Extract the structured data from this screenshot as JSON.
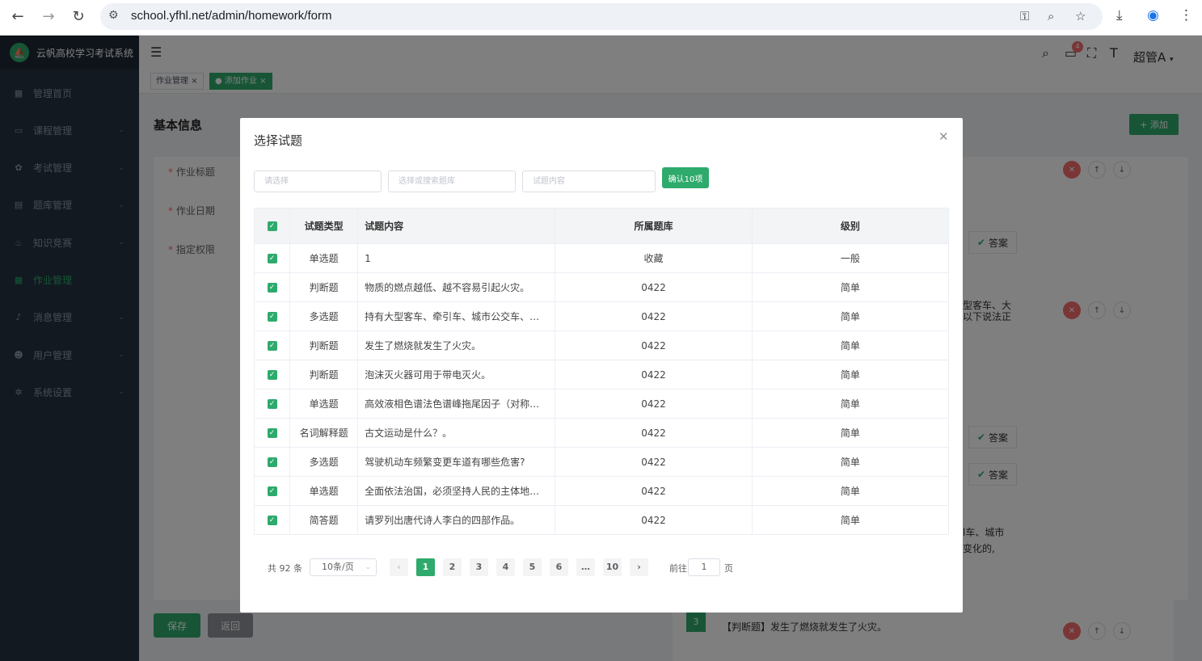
{
  "browser": {
    "url": "school.yfhl.net/admin/homework/form"
  },
  "sidebar": {
    "app_name": "云帆高校学习考试系统",
    "items": [
      {
        "label": "管理首页",
        "icon": "dashboard-icon",
        "has_children": false,
        "active": false
      },
      {
        "label": "课程管理",
        "icon": "monitor-icon",
        "has_children": true,
        "active": false
      },
      {
        "label": "考试管理",
        "icon": "gear-icon",
        "has_children": true,
        "active": false
      },
      {
        "label": "题库管理",
        "icon": "document-icon",
        "has_children": true,
        "active": false
      },
      {
        "label": "知识竞赛",
        "icon": "flame-icon",
        "has_children": true,
        "active": false
      },
      {
        "label": "作业管理",
        "icon": "table-icon",
        "has_children": false,
        "active": true
      },
      {
        "label": "消息管理",
        "icon": "bell-icon",
        "has_children": true,
        "active": false
      },
      {
        "label": "用户管理",
        "icon": "user-icon",
        "has_children": true,
        "active": false
      },
      {
        "label": "系统设置",
        "icon": "settings-icon",
        "has_children": true,
        "active": false
      }
    ]
  },
  "topbar": {
    "notification_count": "4",
    "user_name": "超管A"
  },
  "tabs": [
    {
      "label": "作业管理",
      "active": false
    },
    {
      "label": "添加作业",
      "active": true
    }
  ],
  "form": {
    "section_title": "基本信息",
    "labels": {
      "title": "作业标题",
      "date": "作业日期",
      "permission": "指定权限"
    },
    "save_label": "保存",
    "back_label": "返回",
    "add_label": "+ 添加",
    "answer_label": "答案",
    "peek_text_1": "型客车、大",
    "peek_text_2": "以下说法正",
    "peek_text_3": "l车、城市",
    "peek_text_4": "变化的,",
    "bottom_question_index": "3",
    "bottom_question_text": "【判断题】发生了燃烧就发生了火灾。"
  },
  "dialog": {
    "title": "选择试题",
    "filters": {
      "type_placeholder": "请选择",
      "bank_placeholder": "选择或搜索题库",
      "content_placeholder": "试题内容"
    },
    "confirm_label": "确认10项",
    "columns": [
      "试题类型",
      "试题内容",
      "所属题库",
      "级别"
    ],
    "rows": [
      {
        "type": "单选题",
        "content": "1",
        "bank": "收藏",
        "level": "一般"
      },
      {
        "type": "判断题",
        "content": "物质的燃点越低、越不容易引起火灾。",
        "bank": "0422",
        "level": "简单"
      },
      {
        "type": "多选题",
        "content": "持有大型客车、牵引车、城市公交车、中型客车、大型货车驾驶证的驾驶人，以下说法正确的是？",
        "bank": "0422",
        "level": "简单"
      },
      {
        "type": "判断题",
        "content": "发生了燃烧就发生了火灾。",
        "bank": "0422",
        "level": "简单"
      },
      {
        "type": "判断题",
        "content": "泡沫灭火器可用于带电灭火。",
        "bank": "0422",
        "level": "简单"
      },
      {
        "type": "单选题",
        "content": "高效液相色谱法色谱峰拖尾因子（对称因子）的计算公式",
        "bank": "0422",
        "level": "简单"
      },
      {
        "type": "名词解释题",
        "content": "古文运动是什么？。",
        "bank": "0422",
        "level": "简单"
      },
      {
        "type": "多选题",
        "content": "驾驶机动车频繁变更车道有哪些危害?",
        "bank": "0422",
        "level": "简单"
      },
      {
        "type": "单选题",
        "content": "全面依法治国，必须坚持人民的主体地位，以下说法正确的是",
        "bank": "0422",
        "level": "简单"
      },
      {
        "type": "简答题",
        "content": "请罗列出唐代诗人李白的四部作品。",
        "bank": "0422",
        "level": "简单"
      }
    ],
    "pagination": {
      "total_text": "共 92 条",
      "page_size": "10条/页",
      "pages": [
        "1",
        "2",
        "3",
        "4",
        "5",
        "6",
        "…",
        "10"
      ],
      "current_page": "1",
      "goto_prefix": "前往",
      "goto_value": "1",
      "goto_suffix": "页"
    }
  },
  "colors": {
    "primary": "#2eaa6c",
    "sidebar_bg": "#243241",
    "danger": "#f56c6c"
  }
}
